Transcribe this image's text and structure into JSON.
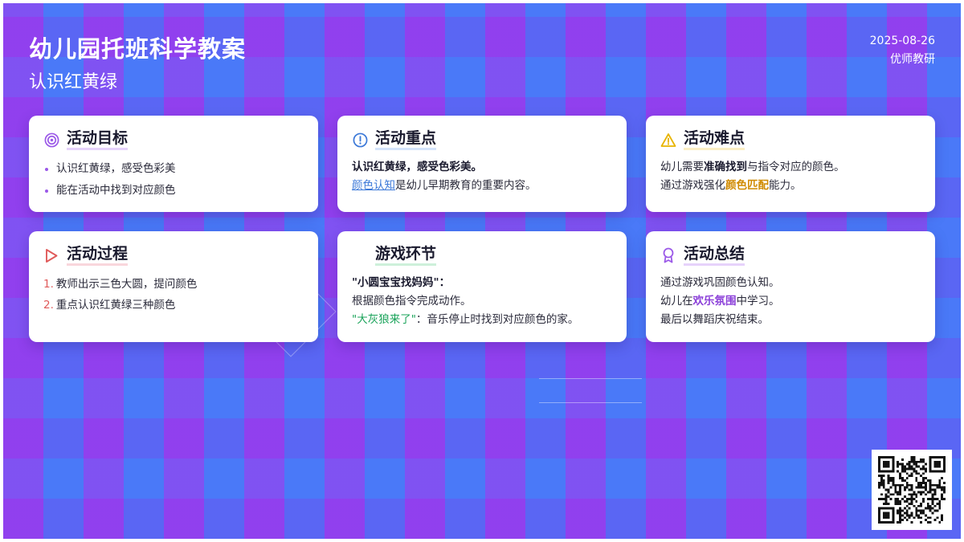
{
  "header": {
    "title": "幼儿园托班科学教案",
    "subtitle": "认识红黄绿",
    "date": "2025-08-26",
    "author": "优师教研"
  },
  "cards": {
    "goal": {
      "title": "活动目标",
      "icon": "target-icon",
      "items": [
        "认识红黄绿，感受色彩美",
        "能在活动中找到对应颜色"
      ]
    },
    "key": {
      "title": "活动重点",
      "icon": "alert-circle-icon",
      "line1": "认识红黄绿，感受色彩美。",
      "line2_link": "颜色认知",
      "line2_rest": "是幼儿早期教育的重要内容。"
    },
    "difficulty": {
      "title": "活动难点",
      "icon": "warning-triangle-icon",
      "line1_pre": "幼儿需要",
      "line1_bold": "准确找到",
      "line1_post": "与指令对应的颜色。",
      "line2_pre": "通过游戏强化",
      "line2_hl": "颜色匹配",
      "line2_post": "能力。"
    },
    "process": {
      "title": "活动过程",
      "icon": "play-triangle-icon",
      "items": [
        {
          "num": "1.",
          "text": "教师出示三色大圆，提问颜色"
        },
        {
          "num": "2.",
          "text": "重点认识红黄绿三种颜色"
        }
      ]
    },
    "game": {
      "title": "游戏环节",
      "line1": "\"小圆宝宝找妈妈\"：",
      "line2": "根据颜色指令完成动作。",
      "line3_hl": "\"大灰狼来了\"",
      "line3_rest": "：音乐停止时找到对应颜色的家。"
    },
    "summary": {
      "title": "活动总结",
      "icon": "award-ribbon-icon",
      "line1": "通过游戏巩固颜色认知。",
      "line2_pre": "幼儿在",
      "line2_hl": "欢乐氛围",
      "line2_post": "中学习。",
      "line3": "最后以舞蹈庆祝结束。"
    }
  },
  "colors": {
    "purple": "#9b59e8",
    "blue": "#3b78d8",
    "yellow": "#e8b400",
    "red": "#e05a5a",
    "green": "#1aa35a"
  },
  "qr": {
    "icon": "qr-code-icon"
  }
}
